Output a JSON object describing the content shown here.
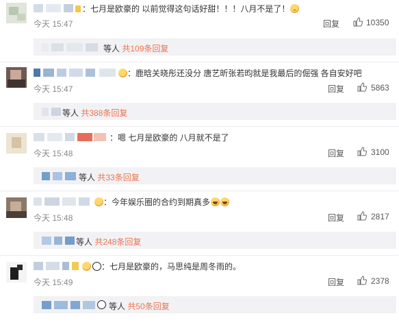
{
  "comments": [
    {
      "text": "：七月是欧豪的 以前觉得这句话好甜！！！八月不是了！",
      "time": "今天 15:47",
      "reply_label": "回复",
      "likes": "10350",
      "sub_users_label": "等人",
      "sub_count": "共109条回复"
    },
    {
      "text": "：鹿晗关晓彤还没分 唐艺昕张若昀就是我最后的倔强 各自安好吧",
      "time": "今天 15:47",
      "reply_label": "回复",
      "likes": "5863",
      "sub_users_label": "等人",
      "sub_count": "共388条回复"
    },
    {
      "text": "：嗯 七月是欧豪的 八月就不是了",
      "time": "今天 15:48",
      "reply_label": "回复",
      "likes": "3100",
      "sub_users_label": "等人",
      "sub_count": "共33条回复"
    },
    {
      "text": "：今年娱乐圈的合约到期真多",
      "time": "今天 15:48",
      "reply_label": "回复",
      "likes": "2817",
      "sub_users_label": "等人",
      "sub_count": "共248条回复"
    },
    {
      "text": "：七月是欧豪的，马思纯是周冬雨的。",
      "time": "今天 15:49",
      "reply_label": "回复",
      "likes": "2378",
      "sub_users_label": "等人",
      "sub_count": "共50条回复"
    }
  ],
  "icons": {
    "like": "thumbs-up-icon",
    "emoji": "smiley-face-icon"
  },
  "colors": {
    "count_link": "#eb7350",
    "time": "#888888",
    "subbox_bg": "#f2f2f5"
  }
}
